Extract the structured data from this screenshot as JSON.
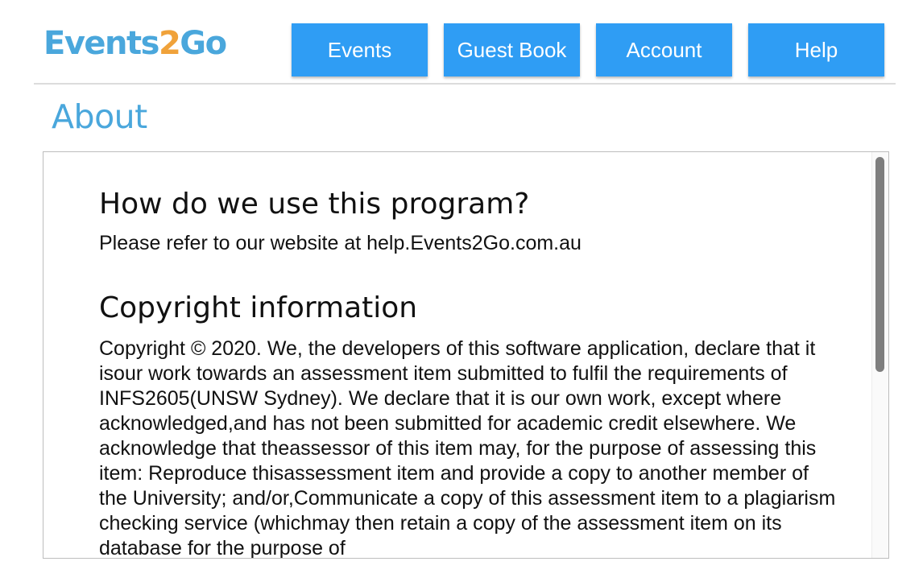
{
  "app": {
    "logo_prefix": "Events",
    "logo_accent": "2",
    "logo_suffix": "Go",
    "logo_colors": {
      "main": "#4aa7dc",
      "accent": "#f0a23a"
    }
  },
  "nav": {
    "items": [
      {
        "label": "Events"
      },
      {
        "label": "Guest Book"
      },
      {
        "label": "Account"
      },
      {
        "label": "Help"
      }
    ],
    "button_color": "#2f9df4"
  },
  "page": {
    "title": "About"
  },
  "content": {
    "sections": [
      {
        "heading": "How do we use this program?",
        "text": "Please refer to our website at help.Events2Go.com.au"
      },
      {
        "heading": "Copyright information",
        "text": "Copyright © 2020. We, the developers of this software application, declare that it isour work towards an assessment item submitted to fulfil the requirements of INFS2605(UNSW Sydney). We declare that it is our own work, except where acknowledged,and has not been submitted for academic credit elsewhere. We acknowledge that theassessor of this item may, for the purpose of assessing this item: Reproduce thisassessment item and provide a copy to another member of the University; and/or,Communicate a copy of this assessment item to a plagiarism checking service (whichmay then retain a copy of the assessment item on its database for the purpose of"
      }
    ]
  }
}
